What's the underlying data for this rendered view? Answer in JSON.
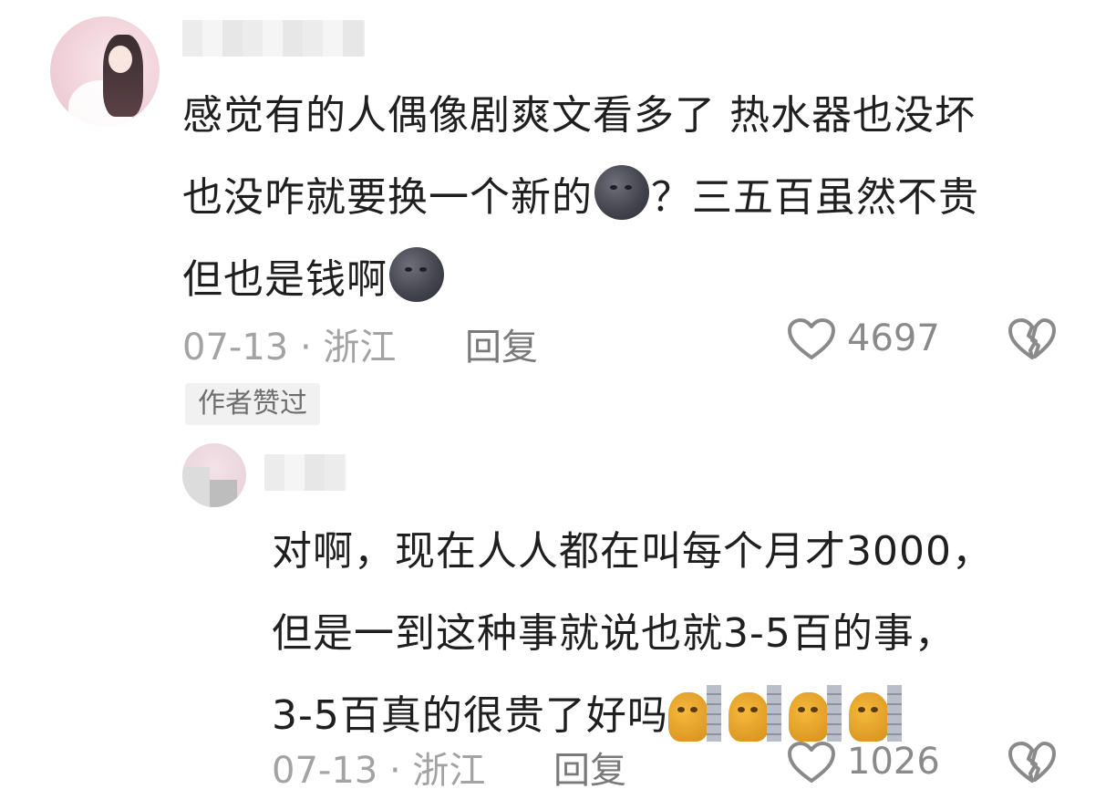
{
  "comment": {
    "lines": [
      "感觉有的人偶像剧爽文看多了 热水器也没坏",
      "也没咋就要换一个新的",
      "？三五百虽然不贵",
      "但也是钱啊"
    ],
    "emoji": "new-moon-face-icon",
    "date": "07-13 · 浙江",
    "reply_label": "回复",
    "like_count": "4697",
    "author_liked_badge": "作者赞过"
  },
  "reply": {
    "lines": [
      "对啊，现在人人都在叫每个月才3000，",
      "但是一到这种事就说也就3-5百的事，",
      "3-5百真的很贵了好吗"
    ],
    "emoji": "cat-behind-wall-icon",
    "date": "07-13 · 浙江",
    "reply_label": "回复",
    "like_count": "1026"
  },
  "colors": {
    "text": "#1f1f1f",
    "meta": "#a3a3a3",
    "icon": "#8a8a8a",
    "badge_bg": "#f1f1f1"
  }
}
